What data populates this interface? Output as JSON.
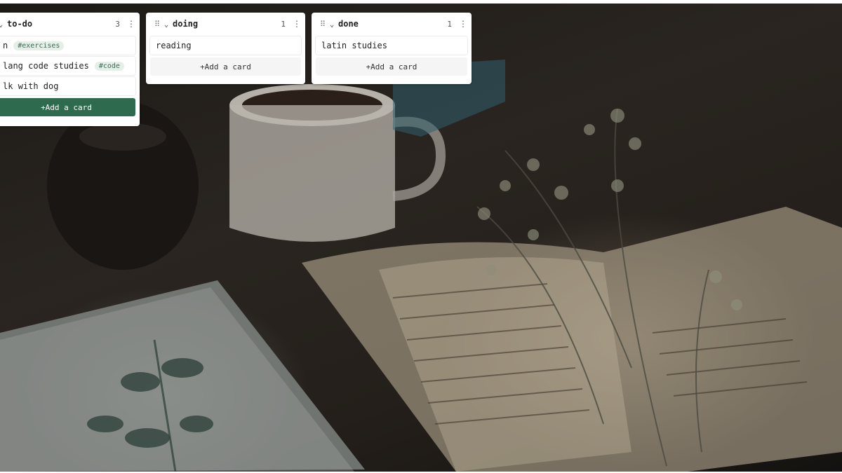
{
  "background": {
    "description_icon": "wallpaper-image"
  },
  "lists": [
    {
      "title": "to-do",
      "count": "3",
      "cards": [
        {
          "text": "n",
          "tag": "#exercises"
        },
        {
          "text": "lang code studies",
          "tag": "#code"
        },
        {
          "text": "lk with dog",
          "tag": ""
        }
      ],
      "add_label": "+Add a card"
    },
    {
      "title": "doing",
      "count": "1",
      "cards": [
        {
          "text": "reading",
          "tag": ""
        }
      ],
      "add_label": "+Add a card"
    },
    {
      "title": "done",
      "count": "1",
      "cards": [
        {
          "text": "latin studies",
          "tag": ""
        }
      ],
      "add_label": "+Add a card"
    }
  ],
  "icons": {
    "drag_handle": "drag-handle-icon",
    "collapse": "chevron-down-icon",
    "menu": "kebab-menu-icon"
  },
  "colors": {
    "primary": "#2e6b4e",
    "tag_bg": "#e4efe8",
    "tag_text": "#3e6a55"
  }
}
